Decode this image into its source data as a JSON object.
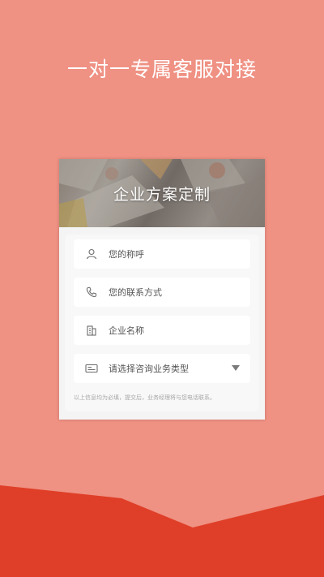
{
  "header": {
    "title": "一对一专属客服对接"
  },
  "card": {
    "banner_title": "企业方案定制",
    "fields": [
      {
        "icon": "user-icon",
        "placeholder": "您的称呼"
      },
      {
        "icon": "phone-icon",
        "placeholder": "您的联系方式"
      },
      {
        "icon": "building-icon",
        "placeholder": "企业名称"
      },
      {
        "icon": "id-card-icon",
        "placeholder": "请选择咨询业务类型",
        "dropdown_icon": "caret-down-icon"
      }
    ],
    "notice": "以上信息均为必填，提交后，业务经理将与您电话联系。"
  },
  "colors": {
    "background": "#ef9183",
    "bottom_accent": "#df3f28",
    "card_bg": "#f4f4f4",
    "field_bg": "#ffffff",
    "text_muted": "#555555"
  }
}
